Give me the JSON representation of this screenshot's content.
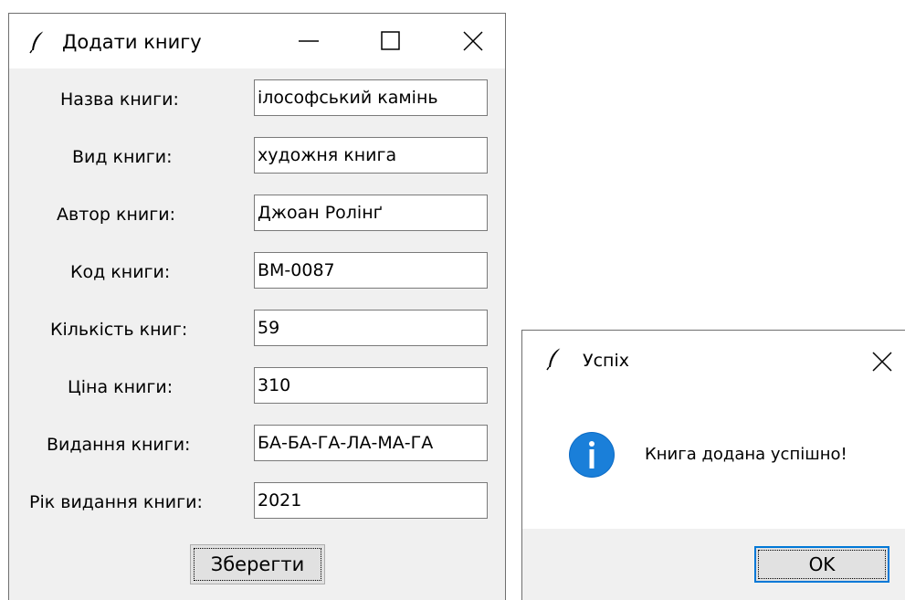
{
  "main_window": {
    "title": "Додати книгу",
    "fields": [
      {
        "label": "Назва книги:",
        "value": "ілософський камінь"
      },
      {
        "label": "Вид книги:",
        "value": "художня книга"
      },
      {
        "label": "Автор книги:",
        "value": "Джоан Ролінґ"
      },
      {
        "label": "Код книги:",
        "value": "ВМ-0087"
      },
      {
        "label": "Кількість книг:",
        "value": "59"
      },
      {
        "label": "Ціна книги:",
        "value": "310"
      },
      {
        "label": "Видання книги:",
        "value": "БА-БА-ГА-ЛА-МА-ГА"
      },
      {
        "label": "Рік видання книги:",
        "value": "2021"
      }
    ],
    "save_label": "Зберегти"
  },
  "message_box": {
    "title": "Успіх",
    "text": "Книга додана успішно!",
    "ok_label": "OK",
    "icon": "info-icon"
  },
  "colors": {
    "window_bg": "#f0f0f0",
    "titlebar_bg": "#ffffff",
    "info_blue": "#0b6ac4",
    "focus_blue": "#0078d7"
  },
  "icons": [
    "feather-icon",
    "minimize-icon",
    "maximize-icon",
    "close-icon",
    "info-icon"
  ]
}
